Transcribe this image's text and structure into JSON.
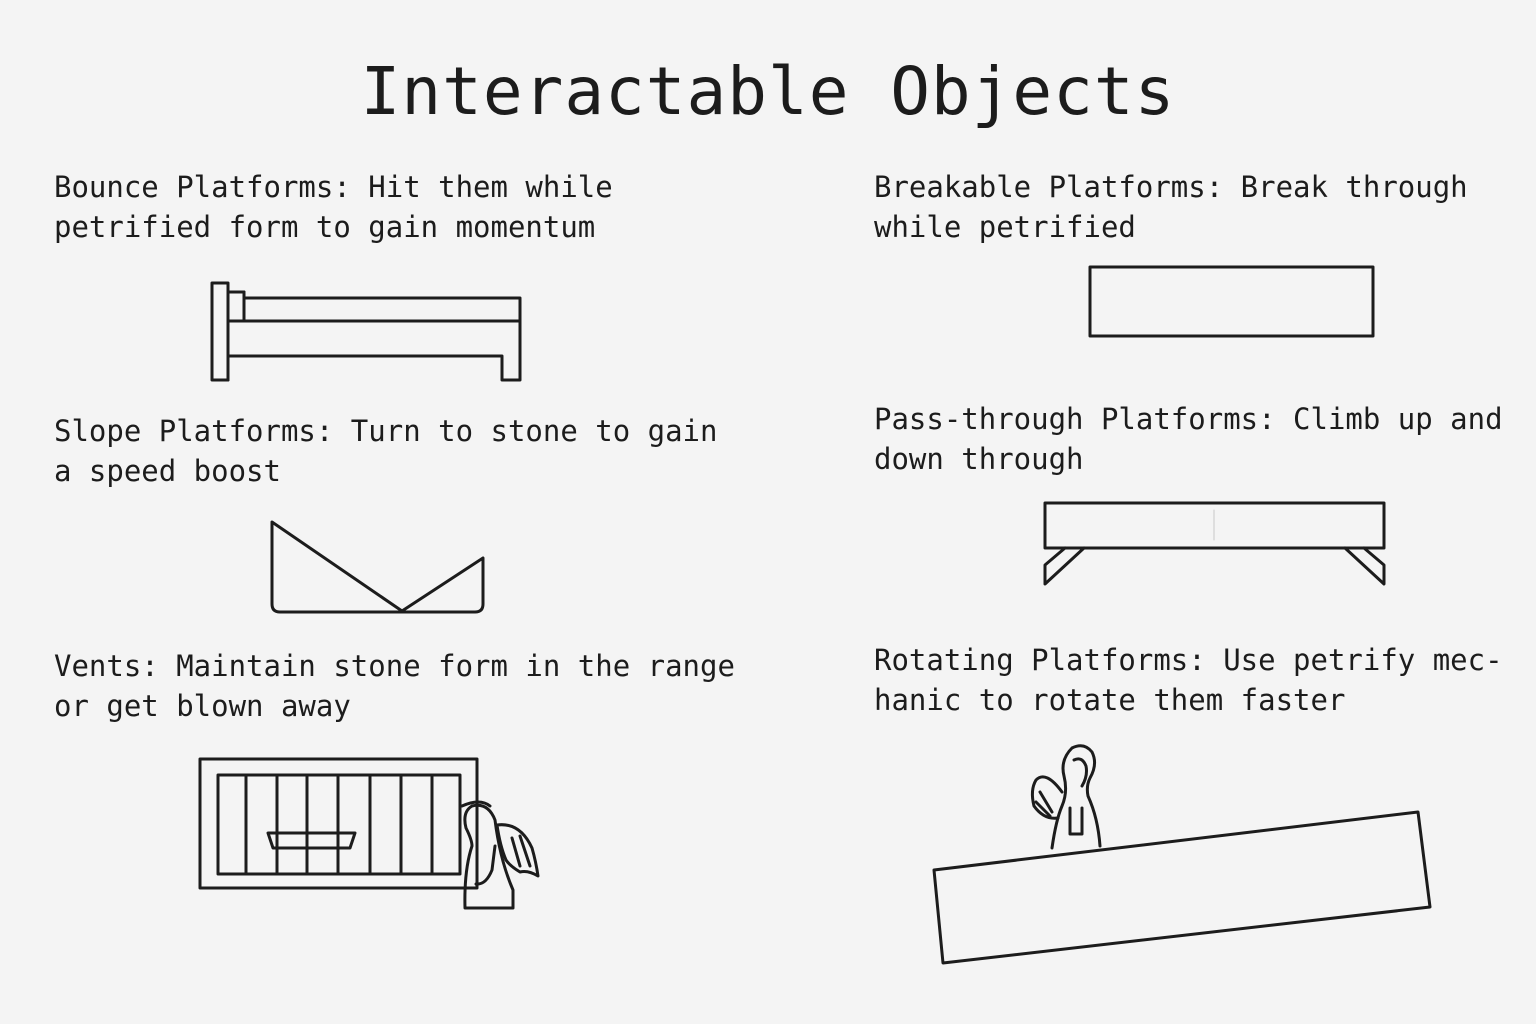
{
  "title": "Interactable Objects",
  "items": [
    {
      "id": "bounce",
      "line1": "Bounce Platforms: Hit them while",
      "line2": "petrified form to gain momentum",
      "icon": "bed-shaped-bounce-platform"
    },
    {
      "id": "breakable",
      "line1": "Breakable Platforms: Break through",
      "line2": "while petrified",
      "icon": "rectangular-breakable-platform"
    },
    {
      "id": "slope",
      "line1": "Slope Platforms: Turn to stone to gain",
      "line2": "a speed boost",
      "icon": "v-shaped-slope-platform"
    },
    {
      "id": "passthrough",
      "line1": "Pass-through Platforms: Climb up and",
      "line2": "down through",
      "icon": "table-shaped-pass-through-platform"
    },
    {
      "id": "vents",
      "line1": "Vents: Maintain stone form in the range",
      "line2": "or get blown away",
      "icon": "vent-grate-with-angel-statue"
    },
    {
      "id": "rotating",
      "line1": "Rotating Platforms: Use petrify mec-",
      "line2": "hanic to rotate them faster",
      "icon": "tilted-platform-with-angel-statue"
    }
  ]
}
